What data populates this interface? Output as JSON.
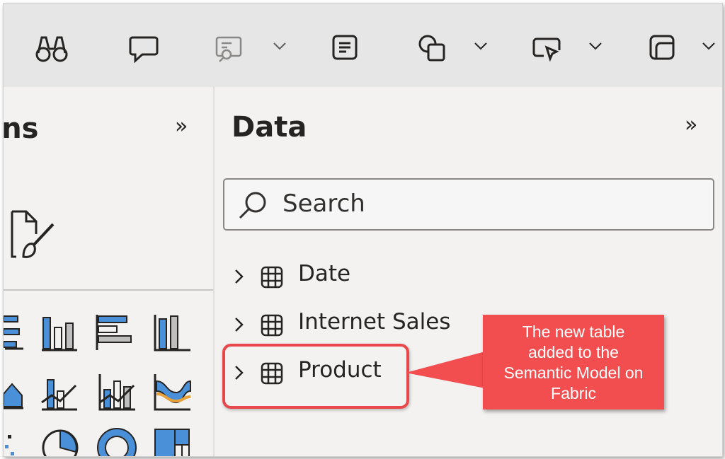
{
  "ribbon": {
    "icons": [
      "binoculars-icon",
      "comment-icon",
      "query-icon",
      "text-box-icon",
      "shapes-icon",
      "button-icon",
      "rounded-square-icon"
    ]
  },
  "visualizations": {
    "title": "Visualizations",
    "visible_title": "ions",
    "collapse_glyph": "»"
  },
  "data_pane": {
    "title": "Data",
    "collapse_glyph": "»",
    "search": {
      "placeholder": "Search",
      "value": ""
    },
    "tables": [
      {
        "label": "Date",
        "expanded": false
      },
      {
        "label": "Internet Sales",
        "expanded": false
      },
      {
        "label": "Product",
        "expanded": false,
        "highlighted": true
      }
    ]
  },
  "annotation": {
    "lines": [
      "The new table",
      "added to the",
      "Semantic Model on",
      "Fabric"
    ],
    "color": "#f24e4f"
  },
  "colors": {
    "accent_blue": "#4a90d9",
    "panel_bg": "#f3f2f1",
    "ribbon_bg": "#e6e6e6"
  }
}
